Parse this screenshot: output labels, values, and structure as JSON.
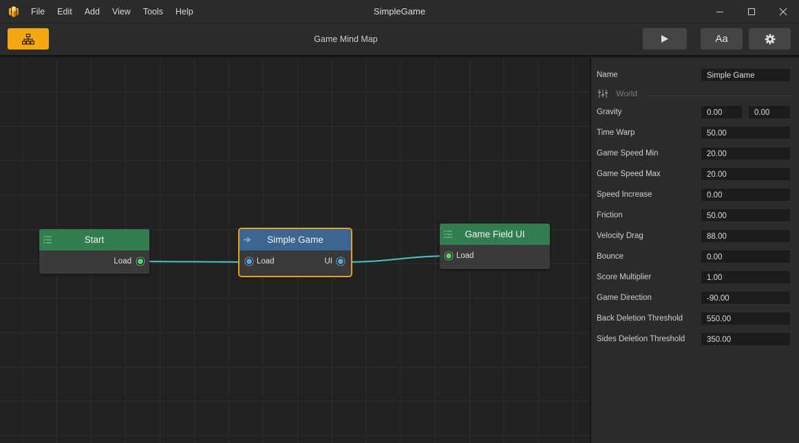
{
  "window": {
    "title": "SimpleGame",
    "menu": [
      "File",
      "Edit",
      "Add",
      "View",
      "Tools",
      "Help"
    ]
  },
  "toolbar": {
    "title": "Game Mind Map",
    "font_button_label": "Aa",
    "colors": {
      "accent": "#f3a712"
    },
    "icons": [
      "hierarchy-icon",
      "play-icon",
      "gear-icon"
    ]
  },
  "nodes": {
    "start": {
      "title": "Start",
      "out_port": "Load"
    },
    "simple_game": {
      "title": "Simple Game",
      "in_port": "Load",
      "out_port": "UI"
    },
    "game_field_ui": {
      "title": "Game Field UI",
      "in_port": "Load"
    }
  },
  "colors": {
    "node_header_green": "#317d4f",
    "node_header_blue": "#3d6591",
    "selection": "#e6a323",
    "wire": "#4fc3d0",
    "port_green": "#4cd964",
    "port_blue": "#4aa8e8"
  },
  "properties": {
    "name_label": "Name",
    "name_value": "Simple Game",
    "section_title": "World",
    "rows": [
      {
        "label": "Gravity",
        "values": [
          "0.00",
          "0.00"
        ]
      },
      {
        "label": "Time Warp",
        "values": [
          "50.00"
        ]
      },
      {
        "label": "Game Speed Min",
        "values": [
          "20.00"
        ]
      },
      {
        "label": "Game Speed Max",
        "values": [
          "20.00"
        ]
      },
      {
        "label": "Speed Increase",
        "values": [
          "0.00"
        ]
      },
      {
        "label": "Friction",
        "values": [
          "50.00"
        ]
      },
      {
        "label": "Velocity Drag",
        "values": [
          "88.00"
        ]
      },
      {
        "label": "Bounce",
        "values": [
          "0.00"
        ]
      },
      {
        "label": "Score Multiplier",
        "values": [
          "1.00"
        ]
      },
      {
        "label": "Game Direction",
        "values": [
          "-90.00"
        ]
      },
      {
        "label": "Back Deletion Threshold",
        "values": [
          "550.00"
        ]
      },
      {
        "label": "Sides Deletion Threshold",
        "values": [
          "350.00"
        ]
      }
    ]
  }
}
